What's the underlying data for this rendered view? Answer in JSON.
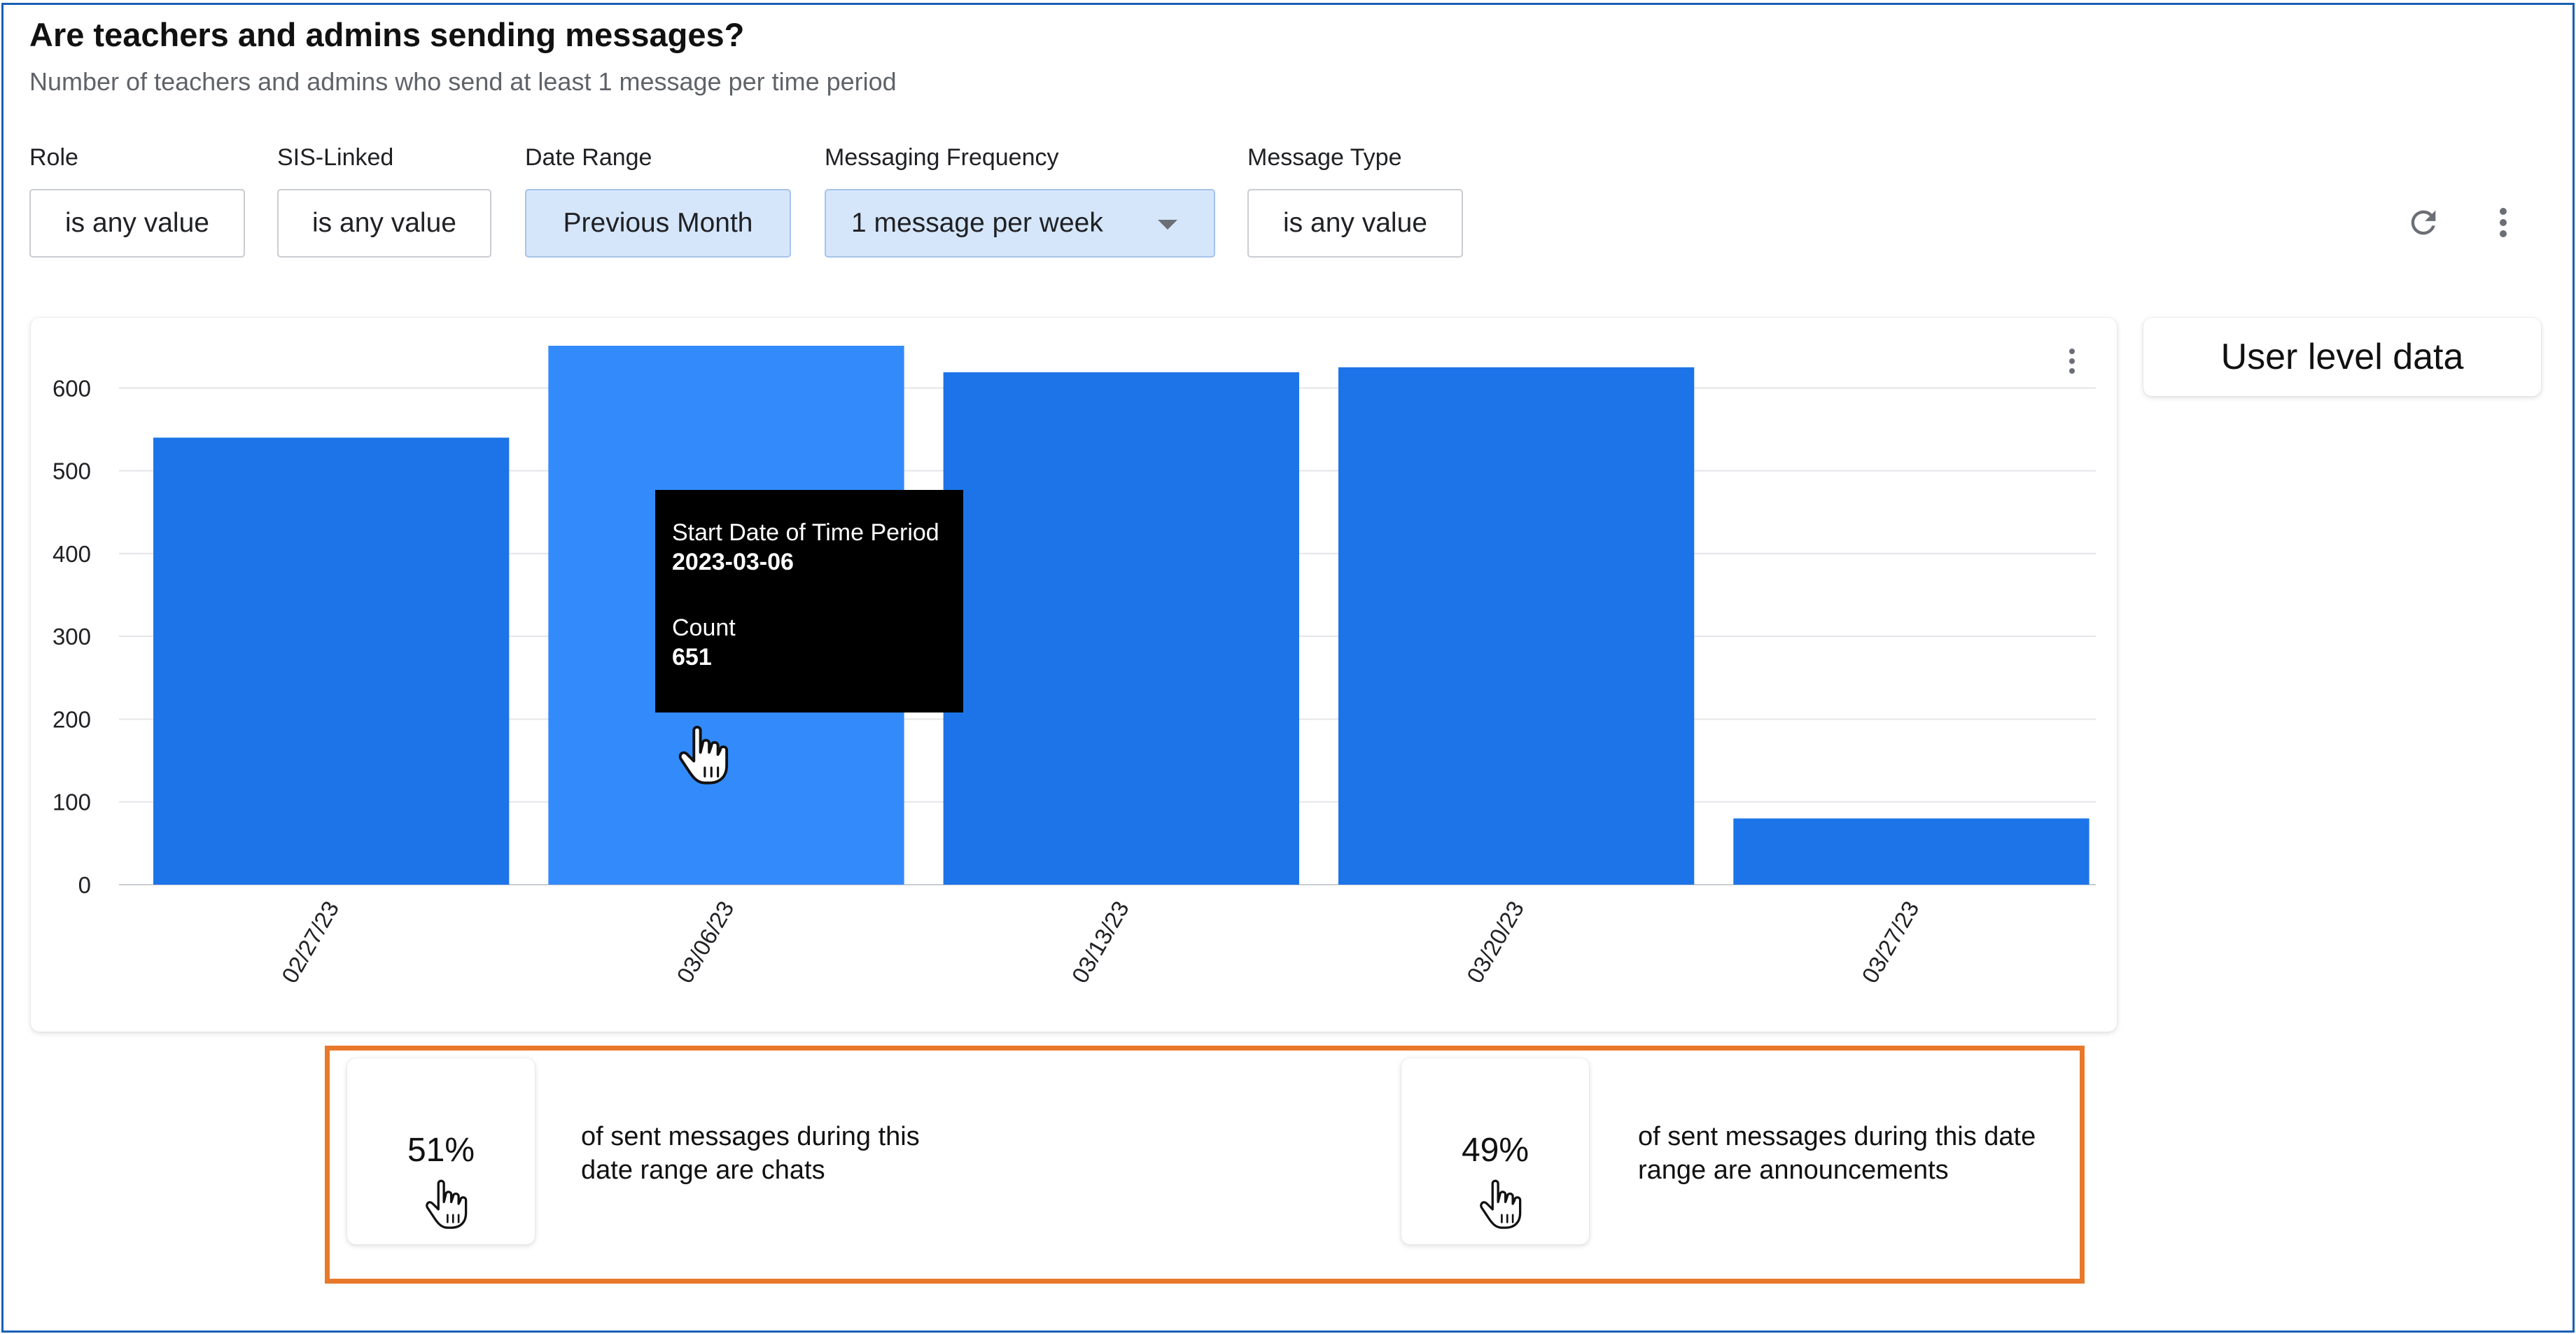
{
  "header": {
    "title": "Are teachers and admins sending messages?",
    "subtitle": "Number of teachers and admins who send at least 1 message per time period"
  },
  "filters": [
    {
      "label": "Role",
      "value": "is any value"
    },
    {
      "label": "SIS-Linked",
      "value": "is any value"
    },
    {
      "label": "Date Range",
      "value": "Previous Month"
    },
    {
      "label": "Messaging Frequency",
      "value": "1 message per week"
    },
    {
      "label": "Message Type",
      "value": "is any value"
    }
  ],
  "toolbar": {
    "refresh_icon": "refresh-icon",
    "more_icon": "more-vert-icon"
  },
  "chart_data": {
    "type": "bar",
    "categories": [
      "02/27/23",
      "03/06/23",
      "03/13/23",
      "03/20/23",
      "03/27/23"
    ],
    "values": [
      540,
      651,
      619,
      625,
      80
    ],
    "ylim": [
      0,
      651
    ],
    "yticks": [
      0,
      100,
      200,
      300,
      400,
      500,
      600
    ],
    "highlighted_index": 1,
    "grid": true,
    "colors": {
      "bar": "#1c74e8",
      "bar_highlight": "#338bfb",
      "grid": "#e3e5e8",
      "tick_text": "#202124"
    }
  },
  "tooltip": {
    "label1": "Start Date of Time Period",
    "value1": "2023-03-06",
    "label2": "Count",
    "value2": "651"
  },
  "side_panel": {
    "button_label": "User level data"
  },
  "stats": [
    {
      "percent": "51%",
      "line1": "of sent messages during this",
      "line2": "date range are chats"
    },
    {
      "percent": "49%",
      "line1": "of sent messages during this date",
      "line2": "range are announcements"
    }
  ],
  "colors": {
    "accent": "#1c74e8",
    "highlight_border": "#e8792b",
    "frame_border": "#1a5fb4"
  }
}
